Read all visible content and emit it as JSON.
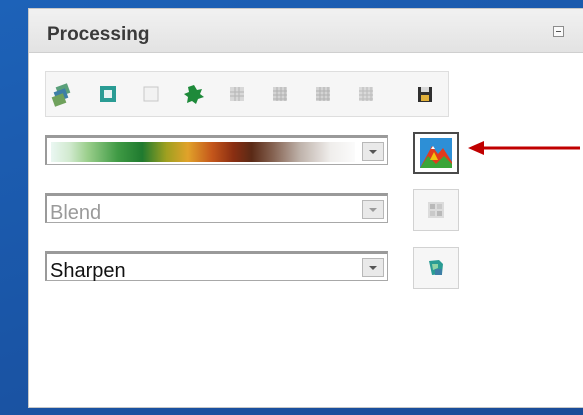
{
  "panel": {
    "title": "Processing"
  },
  "toolbar": {
    "tools": [
      {
        "icon": "layers-icon"
      },
      {
        "icon": "image-frame-icon"
      },
      {
        "icon": "blank-icon"
      },
      {
        "icon": "leaf-icon"
      },
      {
        "icon": "grid-icon"
      },
      {
        "icon": "grid-icon"
      },
      {
        "icon": "grid-icon"
      },
      {
        "icon": "grid-icon"
      },
      {
        "icon": "save-icon"
      }
    ]
  },
  "colormap": {
    "selected": "",
    "state": "enabled"
  },
  "blend": {
    "value": "Blend",
    "state": "disabled"
  },
  "sharpen": {
    "value": "Sharpen",
    "state": "enabled"
  },
  "buttons": {
    "colormap_apply": {
      "icon": "hillshade-icon",
      "state": "active"
    },
    "blend_apply": {
      "icon": "blend-icon",
      "state": "disabled"
    },
    "sharpen_apply": {
      "icon": "sharpen-icon",
      "state": "enabled"
    }
  },
  "colors": {
    "background": "#1d62b8",
    "arrow": "#c00000",
    "panel": "#ffffff"
  }
}
